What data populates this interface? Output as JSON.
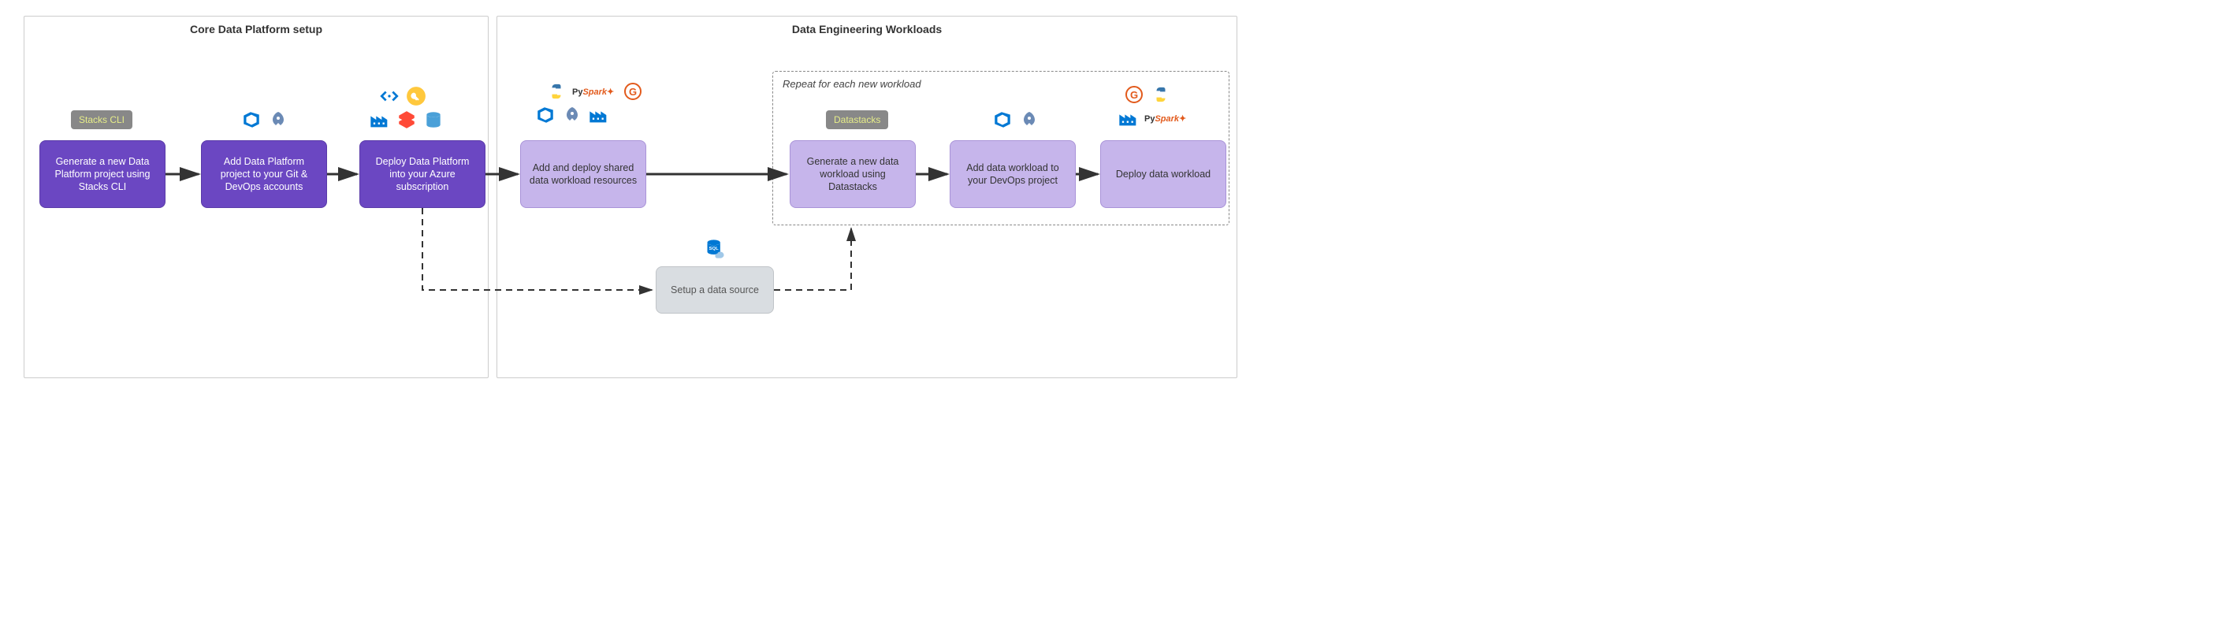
{
  "groups": {
    "left": {
      "title": "Core Data Platform setup"
    },
    "right": {
      "title": "Data Engineering Workloads"
    },
    "repeat": {
      "title": "Repeat for each new workload"
    }
  },
  "badges": {
    "stacks_cli": "Stacks CLI",
    "datastacks": "Datastacks"
  },
  "boxes": {
    "b1": "Generate a new Data Platform project using Stacks CLI",
    "b2": "Add Data Platform project to your Git & DevOps accounts",
    "b3": "Deploy Data Platform into your Azure subscription",
    "b4": "Add and deploy shared data workload resources",
    "b5": "Generate a new data workload using Datastacks",
    "b6": "Add data workload to your DevOps project",
    "b7": "Deploy data workload",
    "b8": "Setup a data source"
  },
  "icons": {
    "devops": "devops-icon",
    "rocket": "rocket-icon",
    "factory": "factory-icon",
    "code": "code-icon",
    "key": "key-icon",
    "databricks": "databricks-icon",
    "cosmos": "cosmos-icon",
    "python": "python-icon",
    "pyspark": "PySpark",
    "g": "g-icon",
    "sql": "sql-icon"
  }
}
